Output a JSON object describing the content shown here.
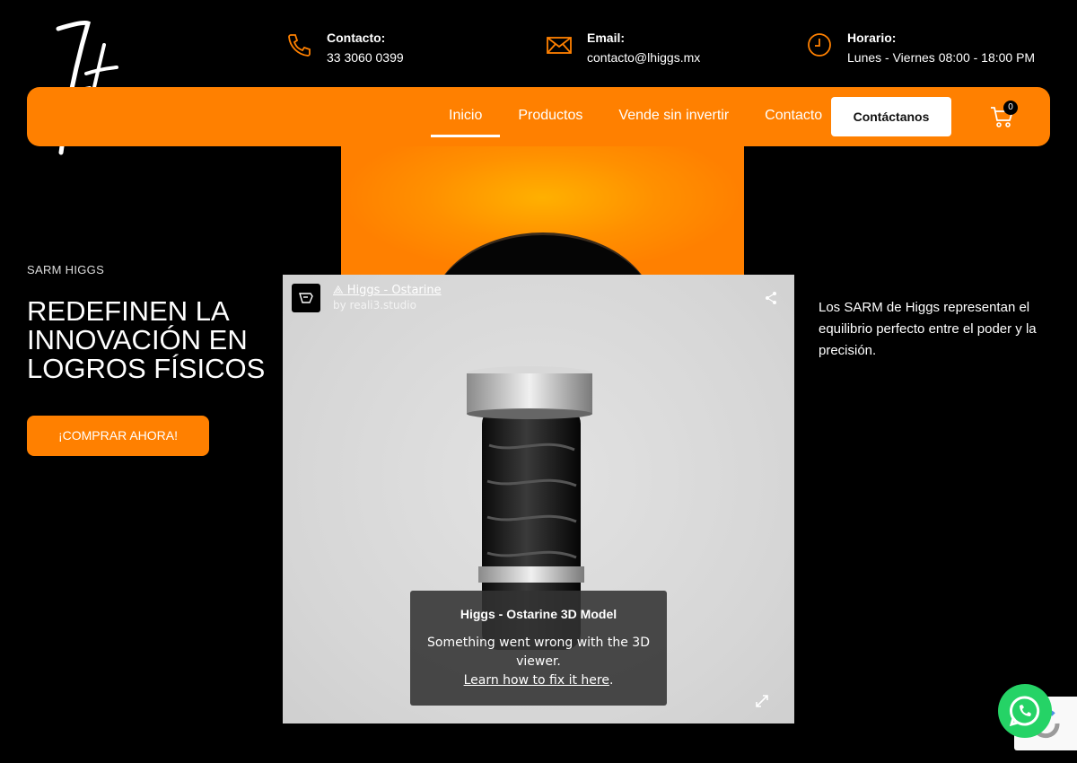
{
  "header": {
    "contact": {
      "label": "Contacto:",
      "value": "33 3060 0399",
      "icon": "phone-icon"
    },
    "email": {
      "label": "Email:",
      "value": "contacto@lhiggs.mx",
      "icon": "envelope-icon"
    },
    "hours": {
      "label": "Horario:",
      "value": "Lunes - Viernes 08:00 - 18:00 PM",
      "icon": "clock-icon"
    }
  },
  "nav": {
    "items": [
      {
        "label": "Inicio",
        "active": true
      },
      {
        "label": "Productos"
      },
      {
        "label": "Vende sin invertir"
      },
      {
        "label": "Contacto"
      }
    ],
    "cta_label": "Contáctanos",
    "cart_count": "0"
  },
  "hero": {
    "eyebrow": "SARM HIGGS",
    "headline": "REDEFINEN LA INNOVACIÓN EN LOGROS FÍSICOS",
    "button_label": "¡COMPRAR AHORA!",
    "description": "Los SARM de Higgs representan el equilibrio perfecto entre el poder y la precisión."
  },
  "viewer": {
    "title": "Higgs - Ostarine",
    "author": "by reali3.studio",
    "error_title": "Higgs - Ostarine 3D Model",
    "error_message": "Something went wrong with the 3D viewer.",
    "error_link": "Learn how to fix it here",
    "error_suffix": "."
  },
  "colors": {
    "accent": "#ff8000",
    "background": "#000000",
    "whatsapp": "#25d366"
  }
}
